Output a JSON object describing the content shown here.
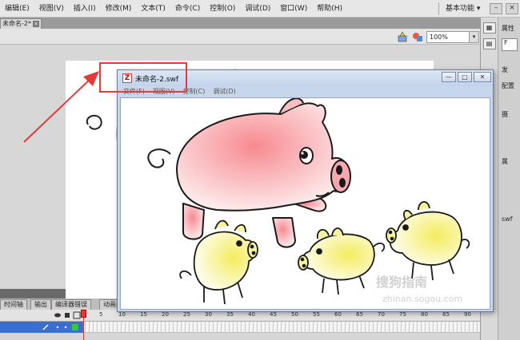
{
  "menubar": {
    "items": [
      "编辑(E)",
      "视图(V)",
      "插入(I)",
      "修改(M)",
      "文本(T)",
      "命令(C)",
      "控制(O)",
      "调试(D)",
      "窗口(W)",
      "帮助(H)"
    ],
    "workspace": "基本功能 ▾",
    "minimize": "–",
    "close": "×"
  },
  "document": {
    "tab_label": "未命名-2*",
    "tab_close": "×",
    "zoom": "100%"
  },
  "right_panel": {
    "properties_title": "属性",
    "publish_label": "发",
    "config_label": "配置",
    "text_1": "摄",
    "section_label": "属",
    "swf_label": "swf"
  },
  "timeline": {
    "tabs": [
      "时间轴",
      "输出",
      "编译器错误",
      "动画编辑器"
    ],
    "frame_numbers": [
      "5",
      "10",
      "15",
      "20",
      "25",
      "30",
      "35",
      "40",
      "45",
      "50",
      "55",
      "60",
      "65",
      "70",
      "75",
      "80",
      "85",
      "90"
    ]
  },
  "swf_window": {
    "icon": "Z",
    "title": "未命名-2.swf",
    "menu": [
      "文件(F)",
      "视图(V)",
      "控制(C)",
      "调试(D)"
    ],
    "minimize": "—",
    "maximize": "□",
    "close": "✕"
  },
  "watermark": {
    "line1": "搜狗指南",
    "line2": "zhinan.sogou.com"
  },
  "colors": {
    "annotation_red": "#e23b3b",
    "pig_pink": "#f39a9f",
    "piglet_yellow": "#f6ef7a",
    "selection_blue": "#3a6fd0",
    "playhead_red": "#ff3333"
  },
  "icons": [
    "edit-scene-icon",
    "edit-symbol-icon",
    "flash-player-icon",
    "minimize-icon",
    "maximize-icon",
    "close-icon",
    "dropdown-arrow-icon"
  ]
}
